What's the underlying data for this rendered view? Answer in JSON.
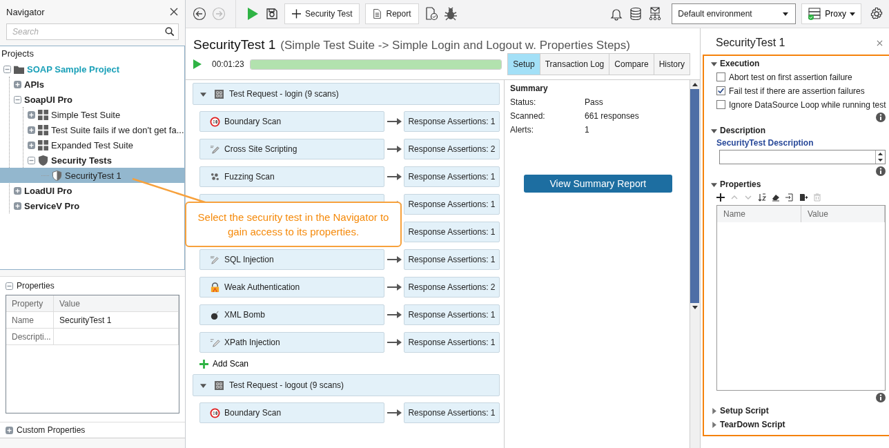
{
  "navigator": {
    "title": "Navigator",
    "search": {
      "placeholder": "Search"
    },
    "tree_label": "Projects",
    "tree": [
      {
        "label": "SOAP Sample Project",
        "kind": "project",
        "expanded": true,
        "selected": false,
        "children": [
          {
            "label": "APIs",
            "kind": "group",
            "expanded": false,
            "selected": false
          },
          {
            "label": "SoapUI Pro",
            "kind": "group",
            "expanded": true,
            "selected": false,
            "children": [
              {
                "label": "Simple Test Suite",
                "kind": "suite",
                "expanded": false,
                "selected": false
              },
              {
                "label": "Test Suite fails if we don't get fa...",
                "kind": "suite",
                "expanded": false,
                "selected": false
              },
              {
                "label": "Expanded Test Suite",
                "kind": "suite",
                "expanded": false,
                "selected": false
              },
              {
                "label": "Security Tests",
                "kind": "security-folder",
                "expanded": true,
                "selected": false,
                "children": [
                  {
                    "label": "SecurityTest 1",
                    "kind": "security-test",
                    "selected": true
                  }
                ]
              }
            ]
          },
          {
            "label": "LoadUI Pro",
            "kind": "group",
            "expanded": false,
            "selected": false
          },
          {
            "label": "ServiceV Pro",
            "kind": "group",
            "expanded": false,
            "selected": false
          }
        ]
      }
    ],
    "properties": {
      "title": "Properties",
      "expanded": true,
      "columns": [
        "Property",
        "Value"
      ],
      "rows": [
        {
          "property": "Name",
          "value": "SecurityTest 1"
        },
        {
          "property": "Descripti..."
        }
      ]
    },
    "custom_properties": {
      "title": "Custom Properties",
      "expanded": false
    }
  },
  "toolbar": {
    "nav": [
      {
        "kind": "back",
        "disabled": false
      },
      {
        "kind": "forward",
        "disabled": true
      }
    ],
    "buttons": [
      {
        "label": "Security Test",
        "kind": "add"
      },
      {
        "label": "Report",
        "kind": "report"
      }
    ],
    "environment": {
      "value": "Default environment"
    },
    "proxy": {
      "label": "Proxy"
    }
  },
  "test": {
    "title": "SecurityTest 1",
    "subtitle": "(Simple Test Suite -> Simple Login and Logout w. Properties Steps)",
    "elapsed": "00:01:23",
    "level": 1,
    "tabs": [
      {
        "label": "Setup",
        "selected": true
      },
      {
        "label": "Transaction Log",
        "selected": false
      },
      {
        "label": "Compare",
        "selected": false
      },
      {
        "label": "History",
        "selected": false
      }
    ],
    "groups": [
      {
        "title": "Test Request - login (9 scans)",
        "expanded": true,
        "add_label": "Add Scan",
        "scans": [
          {
            "kind": "boundary",
            "name": "Boundary Scan",
            "assertions": "Response Assertions: 1"
          },
          {
            "kind": "xss",
            "name": "Cross Site Scripting",
            "assertions": "Response Assertions: 2"
          },
          {
            "kind": "fuzzing",
            "name": "Fuzzing Scan",
            "assertions": "Response Assertions: 1"
          },
          {
            "assertions": "Response Assertions: 1"
          },
          {
            "assertions": "Response Assertions: 1"
          },
          {
            "kind": "sql",
            "name": "SQL Injection",
            "assertions": "Response Assertions: 1"
          },
          {
            "kind": "weak-auth",
            "name": "Weak Authentication",
            "assertions": "Response Assertions: 2"
          },
          {
            "kind": "xml-bomb",
            "name": "XML Bomb",
            "assertions": "Response Assertions: 1"
          },
          {
            "kind": "xpath",
            "name": "XPath Injection",
            "assertions": "Response Assertions: 1"
          }
        ]
      },
      {
        "title": "Test Request - logout (9 scans)",
        "expanded": true,
        "scans": [
          {
            "kind": "boundary",
            "name": "Boundary Scan",
            "assertions": "Response Assertions: 1"
          }
        ]
      }
    ],
    "summary": {
      "title": "Summary",
      "rows": [
        {
          "label": "Status:",
          "value": "Pass"
        },
        {
          "label": "Scanned:",
          "value": "661 responses"
        },
        {
          "label": "Alerts:",
          "value": "1"
        }
      ],
      "button": "View Summary Report"
    }
  },
  "inspector": {
    "title": "SecurityTest 1",
    "sections": [
      {
        "kind": "execution",
        "title": "Execution",
        "expanded": true,
        "options": [
          {
            "label": "Abort test on first assertion failure",
            "checked": false
          },
          {
            "label": "Fail test if there are assertion failures",
            "checked": true
          },
          {
            "label": "Ignore DataSource Loop while running test",
            "checked": false
          }
        ]
      },
      {
        "kind": "description",
        "title": "Description",
        "expanded": true,
        "label": "SecurityTest Description"
      },
      {
        "kind": "properties",
        "title": "Properties",
        "expanded": true,
        "columns": [
          "Name",
          "Value"
        ]
      },
      {
        "kind": "script",
        "title": "Setup Script",
        "expanded": false
      },
      {
        "kind": "script",
        "title": "TearDown Script",
        "expanded": false
      }
    ]
  },
  "callout": {
    "text": "Select the security test in the Navigator to gain access to its properties."
  }
}
